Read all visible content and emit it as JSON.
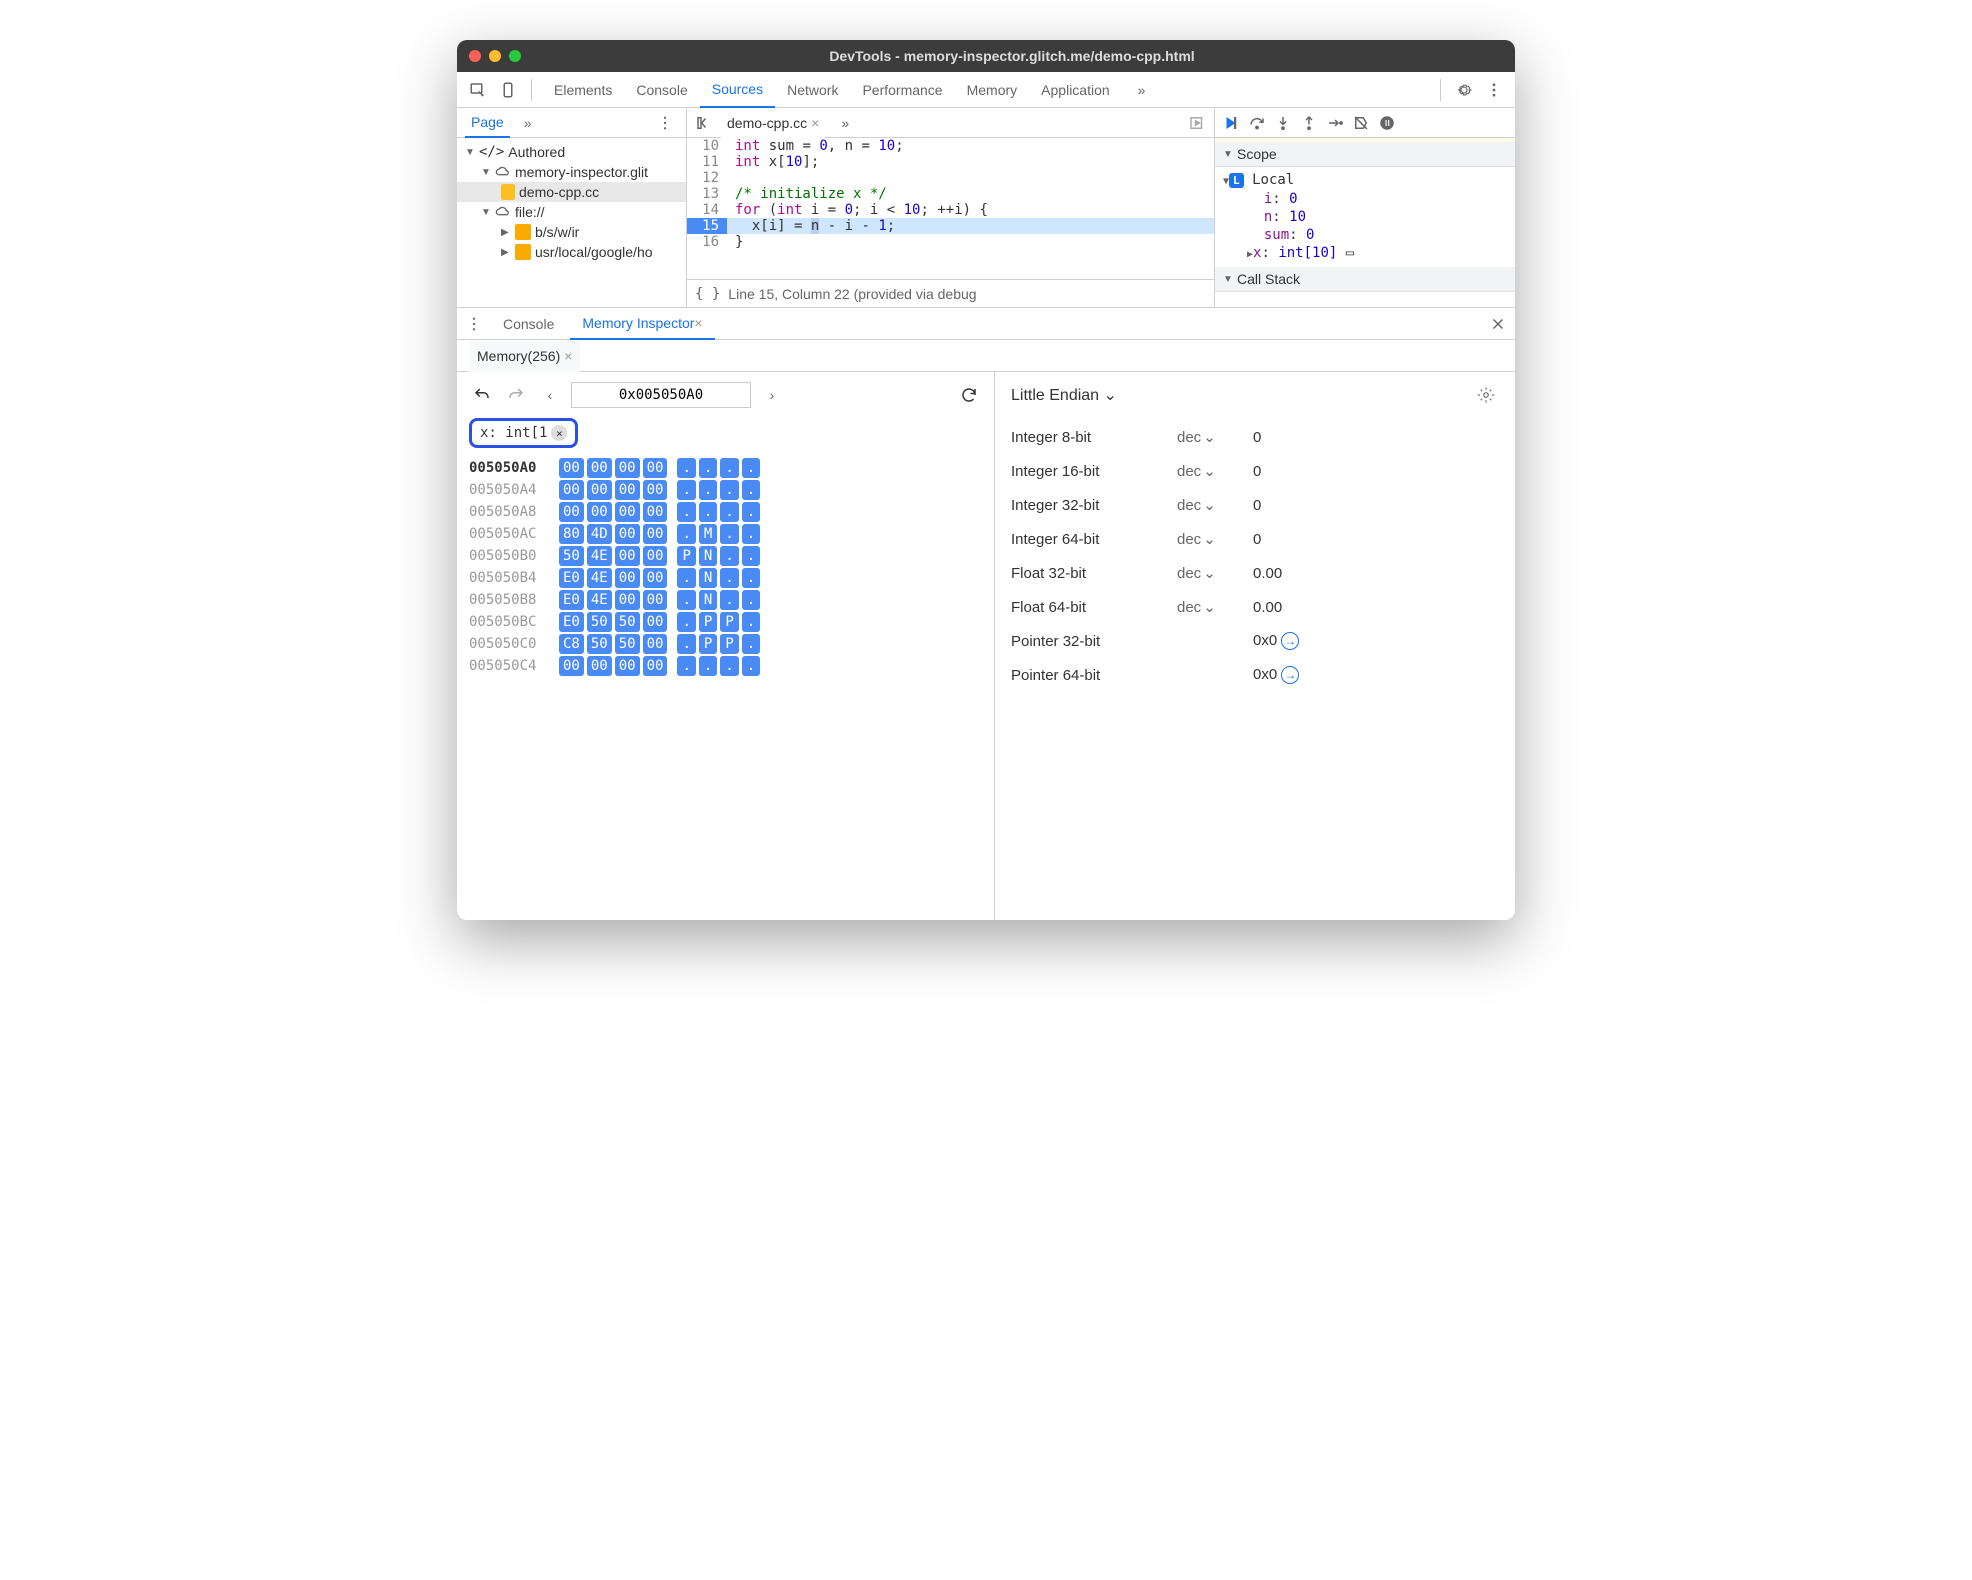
{
  "window": {
    "title": "DevTools - memory-inspector.glitch.me/demo-cpp.html"
  },
  "topTabs": [
    "Elements",
    "Console",
    "Sources",
    "Network",
    "Performance",
    "Memory",
    "Application"
  ],
  "topActiveTab": "Sources",
  "overflowGlyph": "»",
  "sidebar": {
    "tab": "Page",
    "tree": {
      "authored": "Authored",
      "origin1": "memory-inspector.glit",
      "file1": "demo-cpp.cc",
      "origin2": "file://",
      "folder1": "b/s/w/ir",
      "folder2": "usr/local/google/ho"
    }
  },
  "editor": {
    "tab": "demo-cpp.cc",
    "status": "Line 15, Column 22 (provided via debug",
    "lines": [
      {
        "n": "10",
        "html": "<span class='kw'>int</span> sum = <span class='num'>0</span>, n = <span class='num'>10</span>;"
      },
      {
        "n": "11",
        "html": "<span class='kw'>int</span> x[<span class='num'>10</span>];"
      },
      {
        "n": "12",
        "html": ""
      },
      {
        "n": "13",
        "html": "<span class='cmt'>/* initialize x */</span>"
      },
      {
        "n": "14",
        "html": "<span class='kw'>for</span> (<span class='kw'>int</span> i = <span class='num'>0</span>; i < <span class='num'>10</span>; ++i) {"
      },
      {
        "n": "15",
        "html": "  x[i] = <span class='word-hl'>n</span> - i - <span class='num'>1</span>;",
        "hl": true
      },
      {
        "n": "16",
        "html": "}"
      }
    ]
  },
  "scope": {
    "header": "Scope",
    "localLabel": "Local",
    "vars": [
      {
        "name": "i",
        "value": "0"
      },
      {
        "name": "n",
        "value": "10"
      },
      {
        "name": "sum",
        "value": "0"
      },
      {
        "name": "x",
        "value": "int[10]",
        "expandable": true
      }
    ],
    "callStackHeader": "Call Stack"
  },
  "drawer": {
    "tabs": [
      "Console",
      "Memory Inspector"
    ],
    "activeTab": "Memory Inspector",
    "memoryTab": "Memory(256)",
    "address": "0x005050A0",
    "chip": "x: int[1",
    "endian": "Little Endian",
    "hexRows": [
      {
        "addr": "005050A0",
        "bold": true,
        "bytes": [
          "00",
          "00",
          "00",
          "00"
        ],
        "ascii": [
          ".",
          ".",
          ".",
          "."
        ]
      },
      {
        "addr": "005050A4",
        "bytes": [
          "00",
          "00",
          "00",
          "00"
        ],
        "ascii": [
          ".",
          ".",
          ".",
          "."
        ]
      },
      {
        "addr": "005050A8",
        "bytes": [
          "00",
          "00",
          "00",
          "00"
        ],
        "ascii": [
          ".",
          ".",
          ".",
          "."
        ]
      },
      {
        "addr": "005050AC",
        "bytes": [
          "80",
          "4D",
          "00",
          "00"
        ],
        "ascii": [
          ".",
          "M",
          ".",
          "."
        ]
      },
      {
        "addr": "005050B0",
        "bytes": [
          "50",
          "4E",
          "00",
          "00"
        ],
        "ascii": [
          "P",
          "N",
          ".",
          "."
        ]
      },
      {
        "addr": "005050B4",
        "bytes": [
          "E0",
          "4E",
          "00",
          "00"
        ],
        "ascii": [
          ".",
          "N",
          ".",
          "."
        ]
      },
      {
        "addr": "005050B8",
        "bytes": [
          "E0",
          "4E",
          "00",
          "00"
        ],
        "ascii": [
          ".",
          "N",
          ".",
          "."
        ]
      },
      {
        "addr": "005050BC",
        "bytes": [
          "E0",
          "50",
          "50",
          "00"
        ],
        "ascii": [
          ".",
          "P",
          "P",
          "."
        ]
      },
      {
        "addr": "005050C0",
        "bytes": [
          "C8",
          "50",
          "50",
          "00"
        ],
        "ascii": [
          ".",
          "P",
          "P",
          "."
        ]
      },
      {
        "addr": "005050C4",
        "bytes": [
          "00",
          "00",
          "00",
          "00"
        ],
        "ascii": [
          ".",
          ".",
          ".",
          "."
        ]
      }
    ],
    "values": [
      {
        "label": "Integer 8-bit",
        "fmt": "dec",
        "value": "0"
      },
      {
        "label": "Integer 16-bit",
        "fmt": "dec",
        "value": "0"
      },
      {
        "label": "Integer 32-bit",
        "fmt": "dec",
        "value": "0"
      },
      {
        "label": "Integer 64-bit",
        "fmt": "dec",
        "value": "0"
      },
      {
        "label": "Float 32-bit",
        "fmt": "dec",
        "value": "0.00"
      },
      {
        "label": "Float 64-bit",
        "fmt": "dec",
        "value": "0.00"
      },
      {
        "label": "Pointer 32-bit",
        "fmt": "",
        "value": "0x0",
        "jump": true
      },
      {
        "label": "Pointer 64-bit",
        "fmt": "",
        "value": "0x0",
        "jump": true
      }
    ]
  }
}
